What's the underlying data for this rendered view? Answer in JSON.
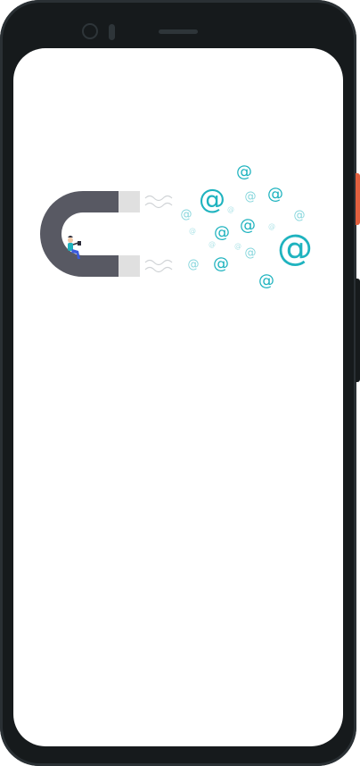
{
  "device": {
    "frame_color": "#161a1c",
    "accent_button_color": "#e2603f"
  },
  "screen": {
    "background": "#ffffff"
  },
  "illustration": {
    "subject": "magnet-attracting-emails",
    "magnet_color": "#585963",
    "magnet_tip_color": "#e0e0e0",
    "email_symbol_color": "#1fb3bf",
    "email_symbol": "@"
  }
}
